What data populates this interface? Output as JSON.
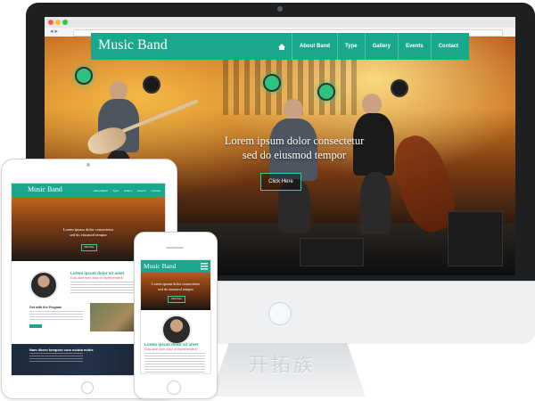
{
  "site": {
    "brand": "Music Band",
    "nav": [
      "About Band",
      "Type",
      "Gallery",
      "Events",
      "Contact"
    ],
    "hero_title_line1": "Lorem ipsum dolor consectetur",
    "hero_title_line2": "sed do eiusmod tempor",
    "hero_button": "Click Here"
  },
  "tablet": {
    "section_title": "Lorem ipsum dolor sit amet",
    "section_subtitle": "Duis aute irure dolor in reprehenderit",
    "section2_title": "Get with the Program",
    "dark_title": "Nam libero tempore cum soluta nobis"
  },
  "phone": {
    "section_title": "Lorem ipsum dolor sit amet",
    "section_subtitle": "Duis aute irure dolor in reprehenderit"
  },
  "watermark": "开拓族",
  "colors": {
    "accent": "#1aa88c",
    "accent_light": "#2ad1b0",
    "highlight": "#d9534f"
  }
}
